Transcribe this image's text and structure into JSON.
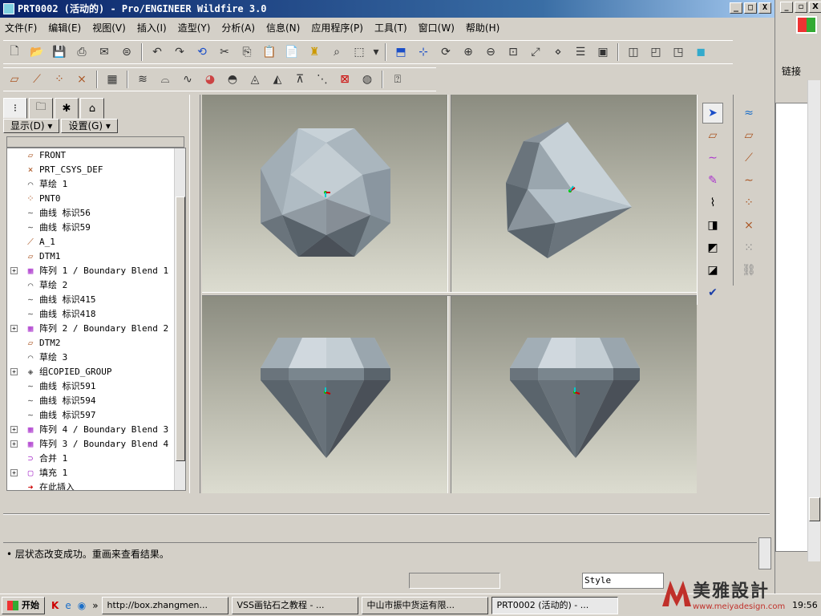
{
  "window": {
    "title": "PRT0002 (活动的) - Pro/ENGINEER Wildfire 3.0",
    "buttons": [
      "_",
      "□",
      "X"
    ]
  },
  "menubar": {
    "items": [
      "文件(F)",
      "编辑(E)",
      "视图(V)",
      "插入(I)",
      "造型(Y)",
      "分析(A)",
      "信息(N)",
      "应用程序(P)",
      "工具(T)",
      "窗口(W)",
      "帮助(H)"
    ]
  },
  "nav": {
    "show_label": "显示(D) ▾",
    "settings_label": "设置(G) ▾",
    "tree": [
      {
        "label": "FRONT",
        "icon": "datum-plane-icon",
        "expand": false
      },
      {
        "label": "PRT_CSYS_DEF",
        "icon": "csys-icon",
        "expand": false
      },
      {
        "label": "草绘 1",
        "icon": "sketch-icon",
        "expand": false
      },
      {
        "label": "PNT0",
        "icon": "point-icon",
        "expand": false
      },
      {
        "label": "曲线 标识56",
        "icon": "curve-icon",
        "expand": false
      },
      {
        "label": "曲线 标识59",
        "icon": "curve-icon",
        "expand": false
      },
      {
        "label": "A_1",
        "icon": "axis-icon",
        "expand": false
      },
      {
        "label": "DTM1",
        "icon": "datum-plane-icon",
        "expand": false
      },
      {
        "label": "阵列 1 / Boundary Blend 1",
        "icon": "pattern-icon",
        "expand": true
      },
      {
        "label": "草绘 2",
        "icon": "sketch-icon",
        "expand": false
      },
      {
        "label": "曲线 标识415",
        "icon": "curve-icon",
        "expand": false
      },
      {
        "label": "曲线 标识418",
        "icon": "curve-icon",
        "expand": false
      },
      {
        "label": "阵列 2 / Boundary Blend 2",
        "icon": "pattern-icon",
        "expand": true
      },
      {
        "label": "DTM2",
        "icon": "datum-plane-icon",
        "expand": false
      },
      {
        "label": "草绘 3",
        "icon": "sketch-icon",
        "expand": false
      },
      {
        "label": "组COPIED_GROUP",
        "icon": "group-icon",
        "expand": true
      },
      {
        "label": "曲线 标识591",
        "icon": "curve-icon",
        "expand": false
      },
      {
        "label": "曲线 标识594",
        "icon": "curve-icon",
        "expand": false
      },
      {
        "label": "曲线 标识597",
        "icon": "curve-icon",
        "expand": false
      },
      {
        "label": "阵列 4 / Boundary Blend 3",
        "icon": "pattern-icon",
        "expand": true
      },
      {
        "label": "阵列 3 / Boundary Blend 4",
        "icon": "pattern-icon",
        "expand": true
      },
      {
        "label": "合并 1",
        "icon": "merge-icon",
        "expand": false
      },
      {
        "label": "填充 1",
        "icon": "fill-icon",
        "expand": true
      },
      {
        "label": "在此插入",
        "icon": "insert-here-icon",
        "expand": false
      }
    ]
  },
  "message": {
    "text": "• 层状态改变成功。重画来查看结果。"
  },
  "status": {
    "style_label": "Style"
  },
  "right_panel": {
    "link_label": "链接"
  },
  "taskbar": {
    "start": "开始",
    "tasks": [
      "http://box.zhangmen...",
      "VSS画钻石之教程 - ...",
      "中山市振中货运有限...",
      "PRT0002 (活动的) - ..."
    ],
    "clock": "19:56"
  },
  "brand": {
    "name": "美雅設計",
    "url": "www.meiyadesign.com"
  },
  "colors": {
    "title_gradient_start": "#0a246a",
    "viewport_top": "#8b8c80",
    "viewport_bottom": "#dcdcd0",
    "diamond_light": "#b8c4cc",
    "diamond_dark": "#4a5058"
  }
}
